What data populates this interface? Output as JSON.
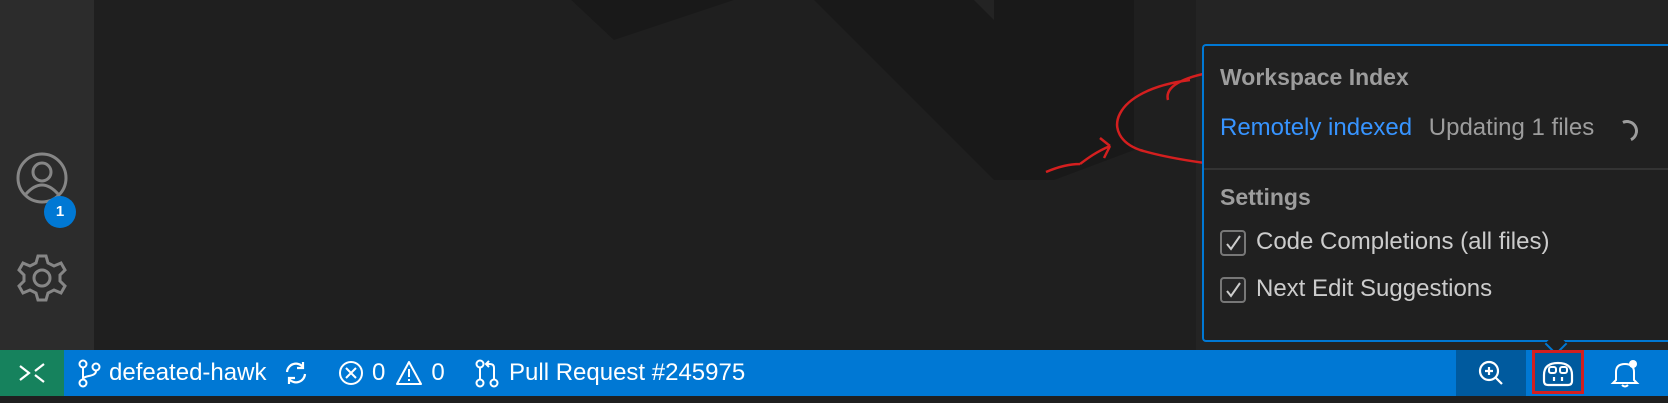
{
  "activity_bar": {
    "accounts_badge": "1",
    "icons": [
      "account-icon",
      "gear-icon"
    ]
  },
  "popup": {
    "workspace_index_title": "Workspace Index",
    "index_state_link": "Remotely indexed",
    "index_status": "Updating 1 files",
    "settings_title": "Settings",
    "settings": [
      {
        "label": "Code Completions (all files)",
        "checked": true
      },
      {
        "label": "Next Edit Suggestions",
        "checked": true
      }
    ]
  },
  "status_bar": {
    "branch": "defeated-hawk",
    "errors": "0",
    "warnings": "0",
    "pull_request": "Pull Request #245975",
    "icons": [
      "remote-icon",
      "branch-icon",
      "sync-icon",
      "error-icon",
      "warning-icon",
      "pull-request-icon",
      "zoom-icon",
      "copilot-icon",
      "bell-icon"
    ]
  },
  "colors": {
    "status_bar": "#0078d4",
    "remote": "#16825d",
    "link": "#3794ff",
    "annotation": "#d41f1f"
  }
}
